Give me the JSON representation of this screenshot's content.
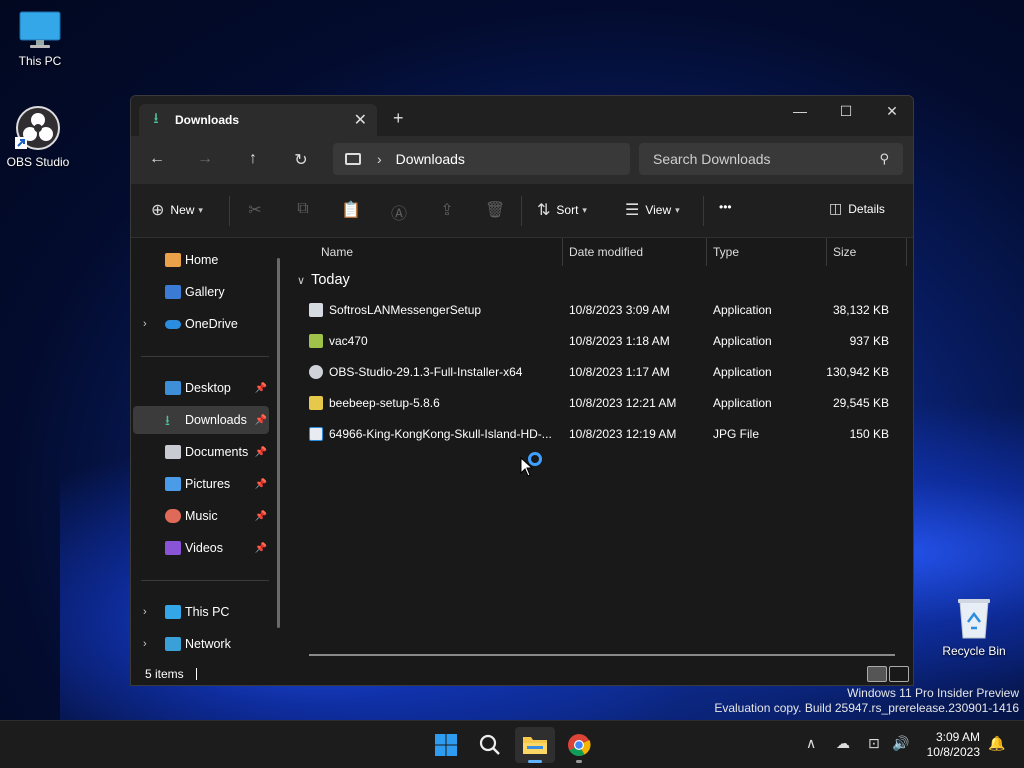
{
  "desktop": {
    "icons": [
      {
        "label": "This PC"
      },
      {
        "label": "OBS Studio"
      },
      {
        "label": "Recycle Bin"
      }
    ]
  },
  "window": {
    "tab_title": "Downloads",
    "breadcrumb": "Downloads",
    "search_placeholder": "Search Downloads",
    "toolbar": {
      "new_label": "New",
      "sort_label": "Sort",
      "view_label": "View",
      "more_label": "•••",
      "details_label": "Details"
    },
    "sidebar": {
      "items": [
        {
          "label": "Home"
        },
        {
          "label": "Gallery"
        },
        {
          "label": "OneDrive"
        },
        {
          "label": "Desktop"
        },
        {
          "label": "Downloads"
        },
        {
          "label": "Documents"
        },
        {
          "label": "Pictures"
        },
        {
          "label": "Music"
        },
        {
          "label": "Videos"
        },
        {
          "label": "This PC"
        },
        {
          "label": "Network"
        }
      ]
    },
    "columns": {
      "name": "Name",
      "date": "Date modified",
      "type": "Type",
      "size": "Size"
    },
    "group": "Today",
    "files": [
      {
        "name": "SoftrosLANMessengerSetup",
        "date": "10/8/2023 3:09 AM",
        "type": "Application",
        "size": "38,132 KB"
      },
      {
        "name": "vac470",
        "date": "10/8/2023 1:18 AM",
        "type": "Application",
        "size": "937 KB"
      },
      {
        "name": "OBS-Studio-29.1.3-Full-Installer-x64",
        "date": "10/8/2023 1:17 AM",
        "type": "Application",
        "size": "130,942 KB"
      },
      {
        "name": "beebeep-setup-5.8.6",
        "date": "10/8/2023 12:21 AM",
        "type": "Application",
        "size": "29,545 KB"
      },
      {
        "name": "64966-King-KongKong-Skull-Island-HD-...",
        "date": "10/8/2023 12:19 AM",
        "type": "JPG File",
        "size": "150 KB"
      }
    ],
    "status": "5 items"
  },
  "watermark": {
    "line1": "Windows 11 Pro Insider Preview",
    "line2": "Evaluation copy. Build 25947.rs_prerelease.230901-1416"
  },
  "taskbar": {
    "time": "3:09 AM",
    "date": "10/8/2023"
  }
}
